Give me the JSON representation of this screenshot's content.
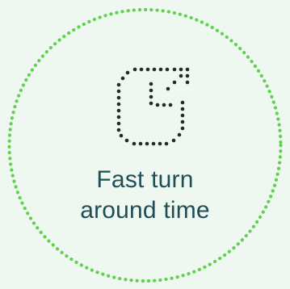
{
  "colors": {
    "background": "#eff7f1",
    "ring": "#5fd14c",
    "icon": "#1f2a2a",
    "text": "#1e4e57"
  },
  "icon": {
    "name": "dotted-square-arrow-icon"
  },
  "caption": {
    "line1": "Fast turn",
    "line2": "around time"
  }
}
